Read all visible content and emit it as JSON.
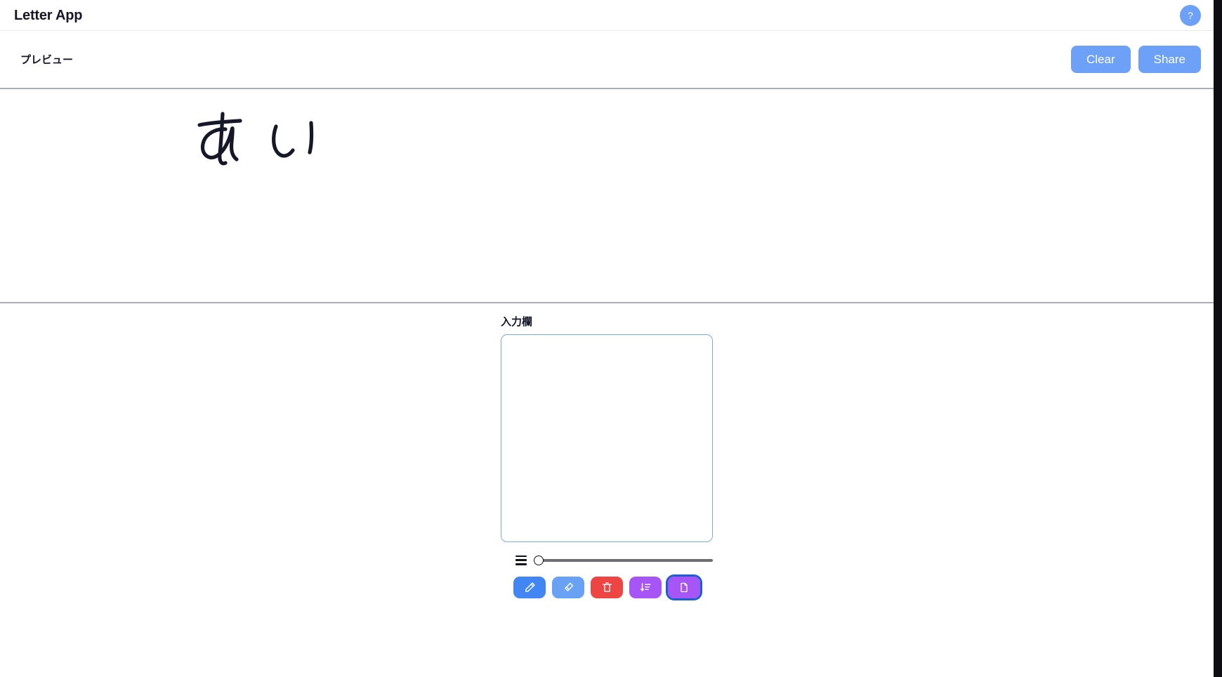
{
  "app": {
    "title": "Letter App",
    "help_label": "?",
    "help_icon": "question-mark-icon"
  },
  "preview": {
    "label": "プレビュー",
    "clear_label": "Clear",
    "share_label": "Share",
    "ink_text": "あい",
    "ink_characters": [
      "あ",
      "い"
    ]
  },
  "input": {
    "label": "入力欄",
    "textarea_value": "",
    "textarea_placeholder": ""
  },
  "stroke": {
    "icon": "line-weight-icon",
    "value": 0,
    "min": 0,
    "max": 100
  },
  "tools": [
    {
      "name": "pen-tool-button",
      "icon": "pencil-icon",
      "color": "#4285f4",
      "focused": false
    },
    {
      "name": "eraser-tool-button",
      "icon": "eraser-icon",
      "color": "#69a1f5",
      "focused": false
    },
    {
      "name": "delete-tool-button",
      "icon": "trash-icon",
      "color": "#ef4444",
      "focused": false
    },
    {
      "name": "sort-tool-button",
      "icon": "sort-desc-icon",
      "color": "#a855f7",
      "focused": false
    },
    {
      "name": "page-tool-button",
      "icon": "document-icon",
      "color": "#a855f7",
      "focused": true
    }
  ],
  "colors": {
    "accent_blue": "#6ca1f7",
    "danger_red": "#ef4444",
    "purple": "#a855f7",
    "focus_ring": "#1b5fd0",
    "divider_light": "#e7e7ed",
    "divider_strong": "#aaadb8",
    "ink": "#16182a"
  }
}
